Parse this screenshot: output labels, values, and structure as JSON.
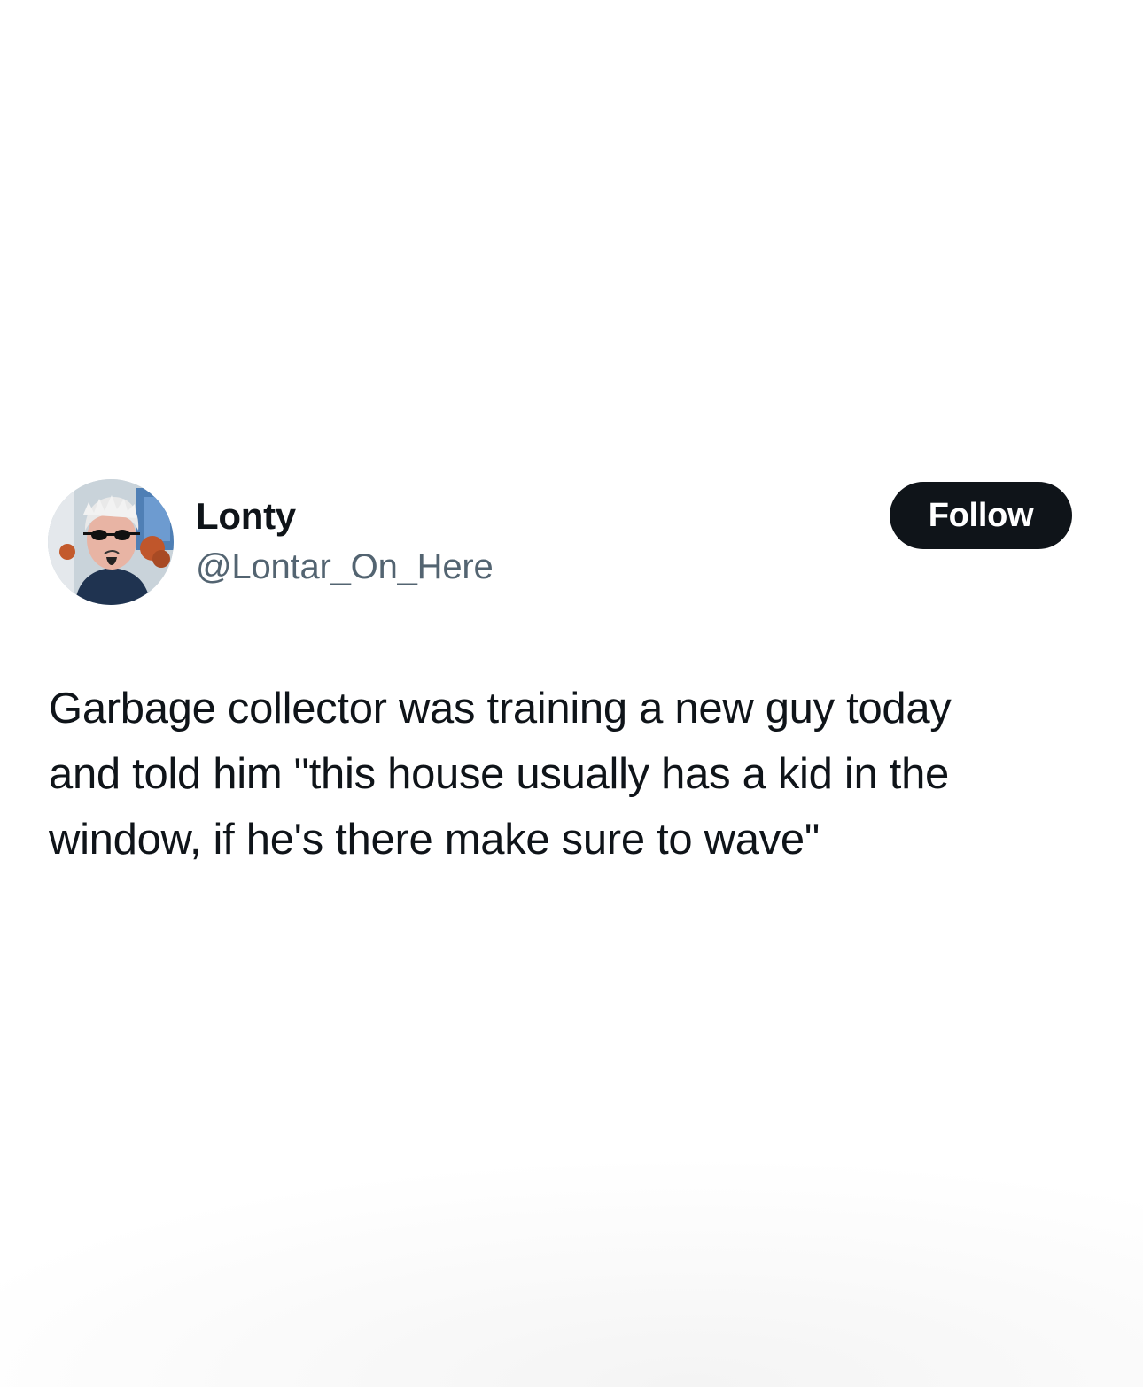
{
  "tweet": {
    "author": {
      "display_name": "Lonty",
      "handle": "@Lontar_On_Here",
      "avatar_icon": "profile-photo-avatar"
    },
    "follow_button_label": "Follow",
    "text_lines": [
      "Garbage collector was training a new guy today",
      "and told him \"this house usually has a kid in the",
      "window, if he's there make sure to wave\""
    ]
  },
  "colors": {
    "background": "#ffffff",
    "primary_text": "#0f1419",
    "secondary_text": "#536471",
    "button_bg": "#0f1419",
    "button_text": "#ffffff"
  }
}
